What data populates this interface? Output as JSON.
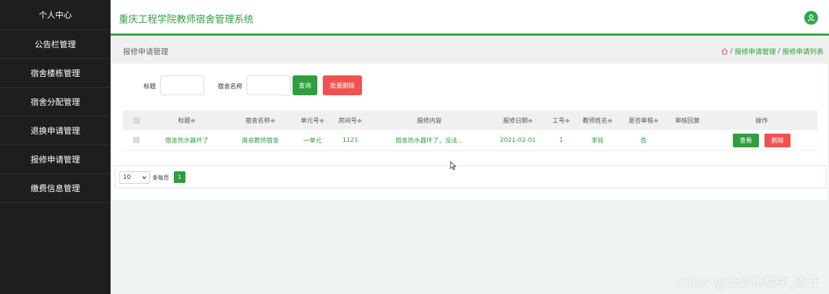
{
  "sidebar": {
    "items": [
      {
        "label": "个人中心"
      },
      {
        "label": "公告栏管理"
      },
      {
        "label": "宿舍楼栋管理"
      },
      {
        "label": "宿舍分配管理"
      },
      {
        "label": "退换申请管理"
      },
      {
        "label": "报修申请管理"
      },
      {
        "label": "缴费信息管理"
      }
    ]
  },
  "header": {
    "title": "重庆工程学院教师宿舍管理系统"
  },
  "crumb": {
    "title": "报修申请管理",
    "breadcrumb_1": "报修申请管理",
    "breadcrumb_2": "报修申请列表",
    "separator": "/"
  },
  "search": {
    "title_label": "标题",
    "title_value": "",
    "dorm_label": "宿舍名称",
    "dorm_value": "",
    "query_label": "查询",
    "batch_delete_label": "批量删除"
  },
  "table": {
    "headers": [
      "标题≑",
      "宿舍名称≑",
      "单元号≑",
      "房间号≑",
      "报修内容",
      "报修日期≑",
      "工号≑",
      "教师姓名≑",
      "是否审核≑",
      "审核回复",
      "操作"
    ],
    "rows": [
      {
        "title": "宿舍热水器坏了",
        "dorm": "南泉教师宿舍",
        "unit": "一单元",
        "room": "1121",
        "content": "宿舍热水器坏了，没法...",
        "date": "2021-02-01",
        "job_no": "1",
        "teacher": "李铭",
        "reviewed": "否",
        "reply": "",
        "view_label": "查看",
        "delete_label": "删除"
      }
    ]
  },
  "pagination": {
    "page_size": "10",
    "per_page_label": "条每页",
    "current_page": "1"
  },
  "watermark": "CSDN @计算机程序_设计",
  "colors": {
    "accent": "#2e9e3f",
    "danger": "#f05252",
    "sidebar": "#1e1e1e"
  }
}
